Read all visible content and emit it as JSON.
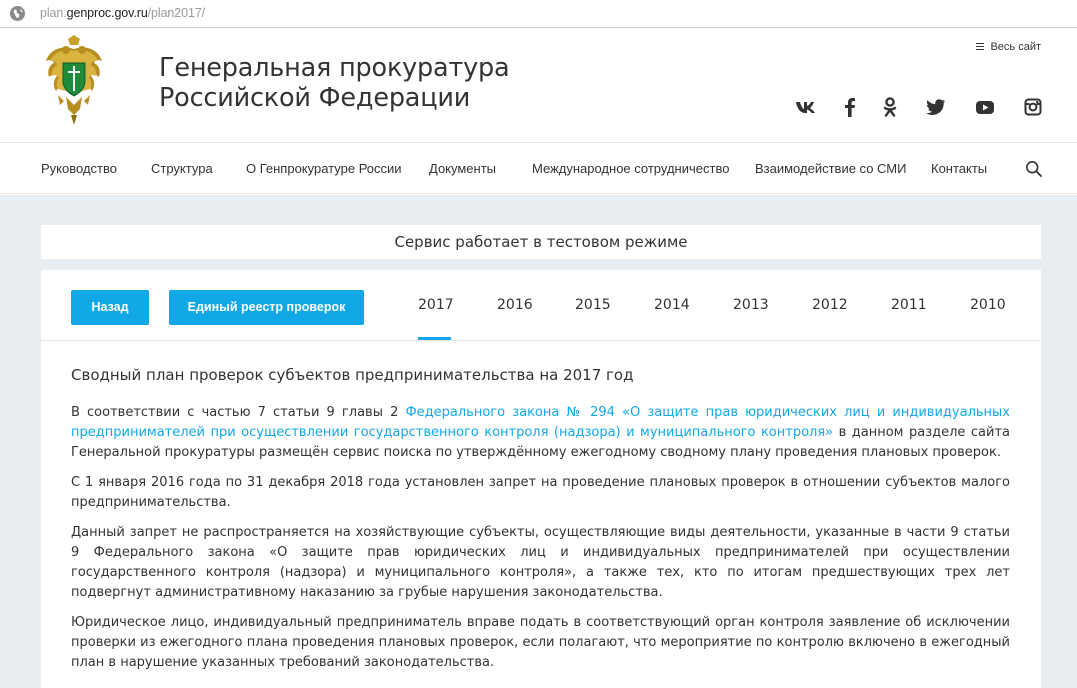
{
  "browser": {
    "url_prefix": "plan.",
    "url_host": "genproc.gov.ru",
    "url_path": "/plan2017/"
  },
  "header": {
    "title_line1": "Генеральная прокуратура",
    "title_line2": "Российской Федерации",
    "sitemap_label": "Весь сайт",
    "socials": [
      "vk-icon",
      "facebook-icon",
      "odnoklassniki-icon",
      "twitter-icon",
      "youtube-icon",
      "instagram-icon"
    ]
  },
  "nav": {
    "items": [
      "Руководство",
      "Структура",
      "О Генпрокуратуре России",
      "Документы",
      "Международное сотрудничество",
      "Взаимодействие со СМИ",
      "Контакты"
    ]
  },
  "notice": "Сервис работает в тестовом режиме",
  "toolbar": {
    "back_label": "Назад",
    "registry_label": "Единый реестр проверок",
    "years": [
      "2017",
      "2016",
      "2015",
      "2014",
      "2013",
      "2012",
      "2011",
      "2010"
    ],
    "active_year": "2017"
  },
  "article": {
    "title": "Сводный план проверок субъектов предпринимательства на 2017 год",
    "p1_before": "В соответствии с частью 7 статьи 9 главы 2 ",
    "p1_link": "Федерального закона № 294 «О защите прав юридических лиц и индивидуальных предпринимателей при осуществлении государственного контроля (надзора) и муниципального контроля»",
    "p1_after": " в данном разделе сайта Генеральной прокуратуры размещён сервис поиска по утверждённому ежегодному сводному плану проведения плановых проверок.",
    "p2": "С 1 января 2016 года по 31 декабря 2018 года установлен запрет на проведение плановых проверок в отношении субъектов малого предпринимательства.",
    "p3": "Данный запрет не распространяется на хозяйствующие субъекты, осуществляющие виды деятельности, указанные в части 9 статьи 9 Федерального закона «О защите прав юридических лиц и индивидуальных предпринимателей при осуществлении государственного контроля (надзора) и муниципального контроля», а также тех, кто по итогам предшествующих трех лет подвергнут административному наказанию за грубые нарушения законодательства.",
    "p4": "Юридическое лицо, индивидуальный предприниматель вправе подать в соответствующий орган контроля заявление об исключении проверки из ежегодного плана проведения плановых проверок, если полагают, что мероприятие по контролю включено в ежегодный план в нарушение указанных требований законодательства."
  },
  "colors": {
    "accent": "#12a8e7",
    "page_bg": "#e7edf0",
    "text": "#333333"
  }
}
